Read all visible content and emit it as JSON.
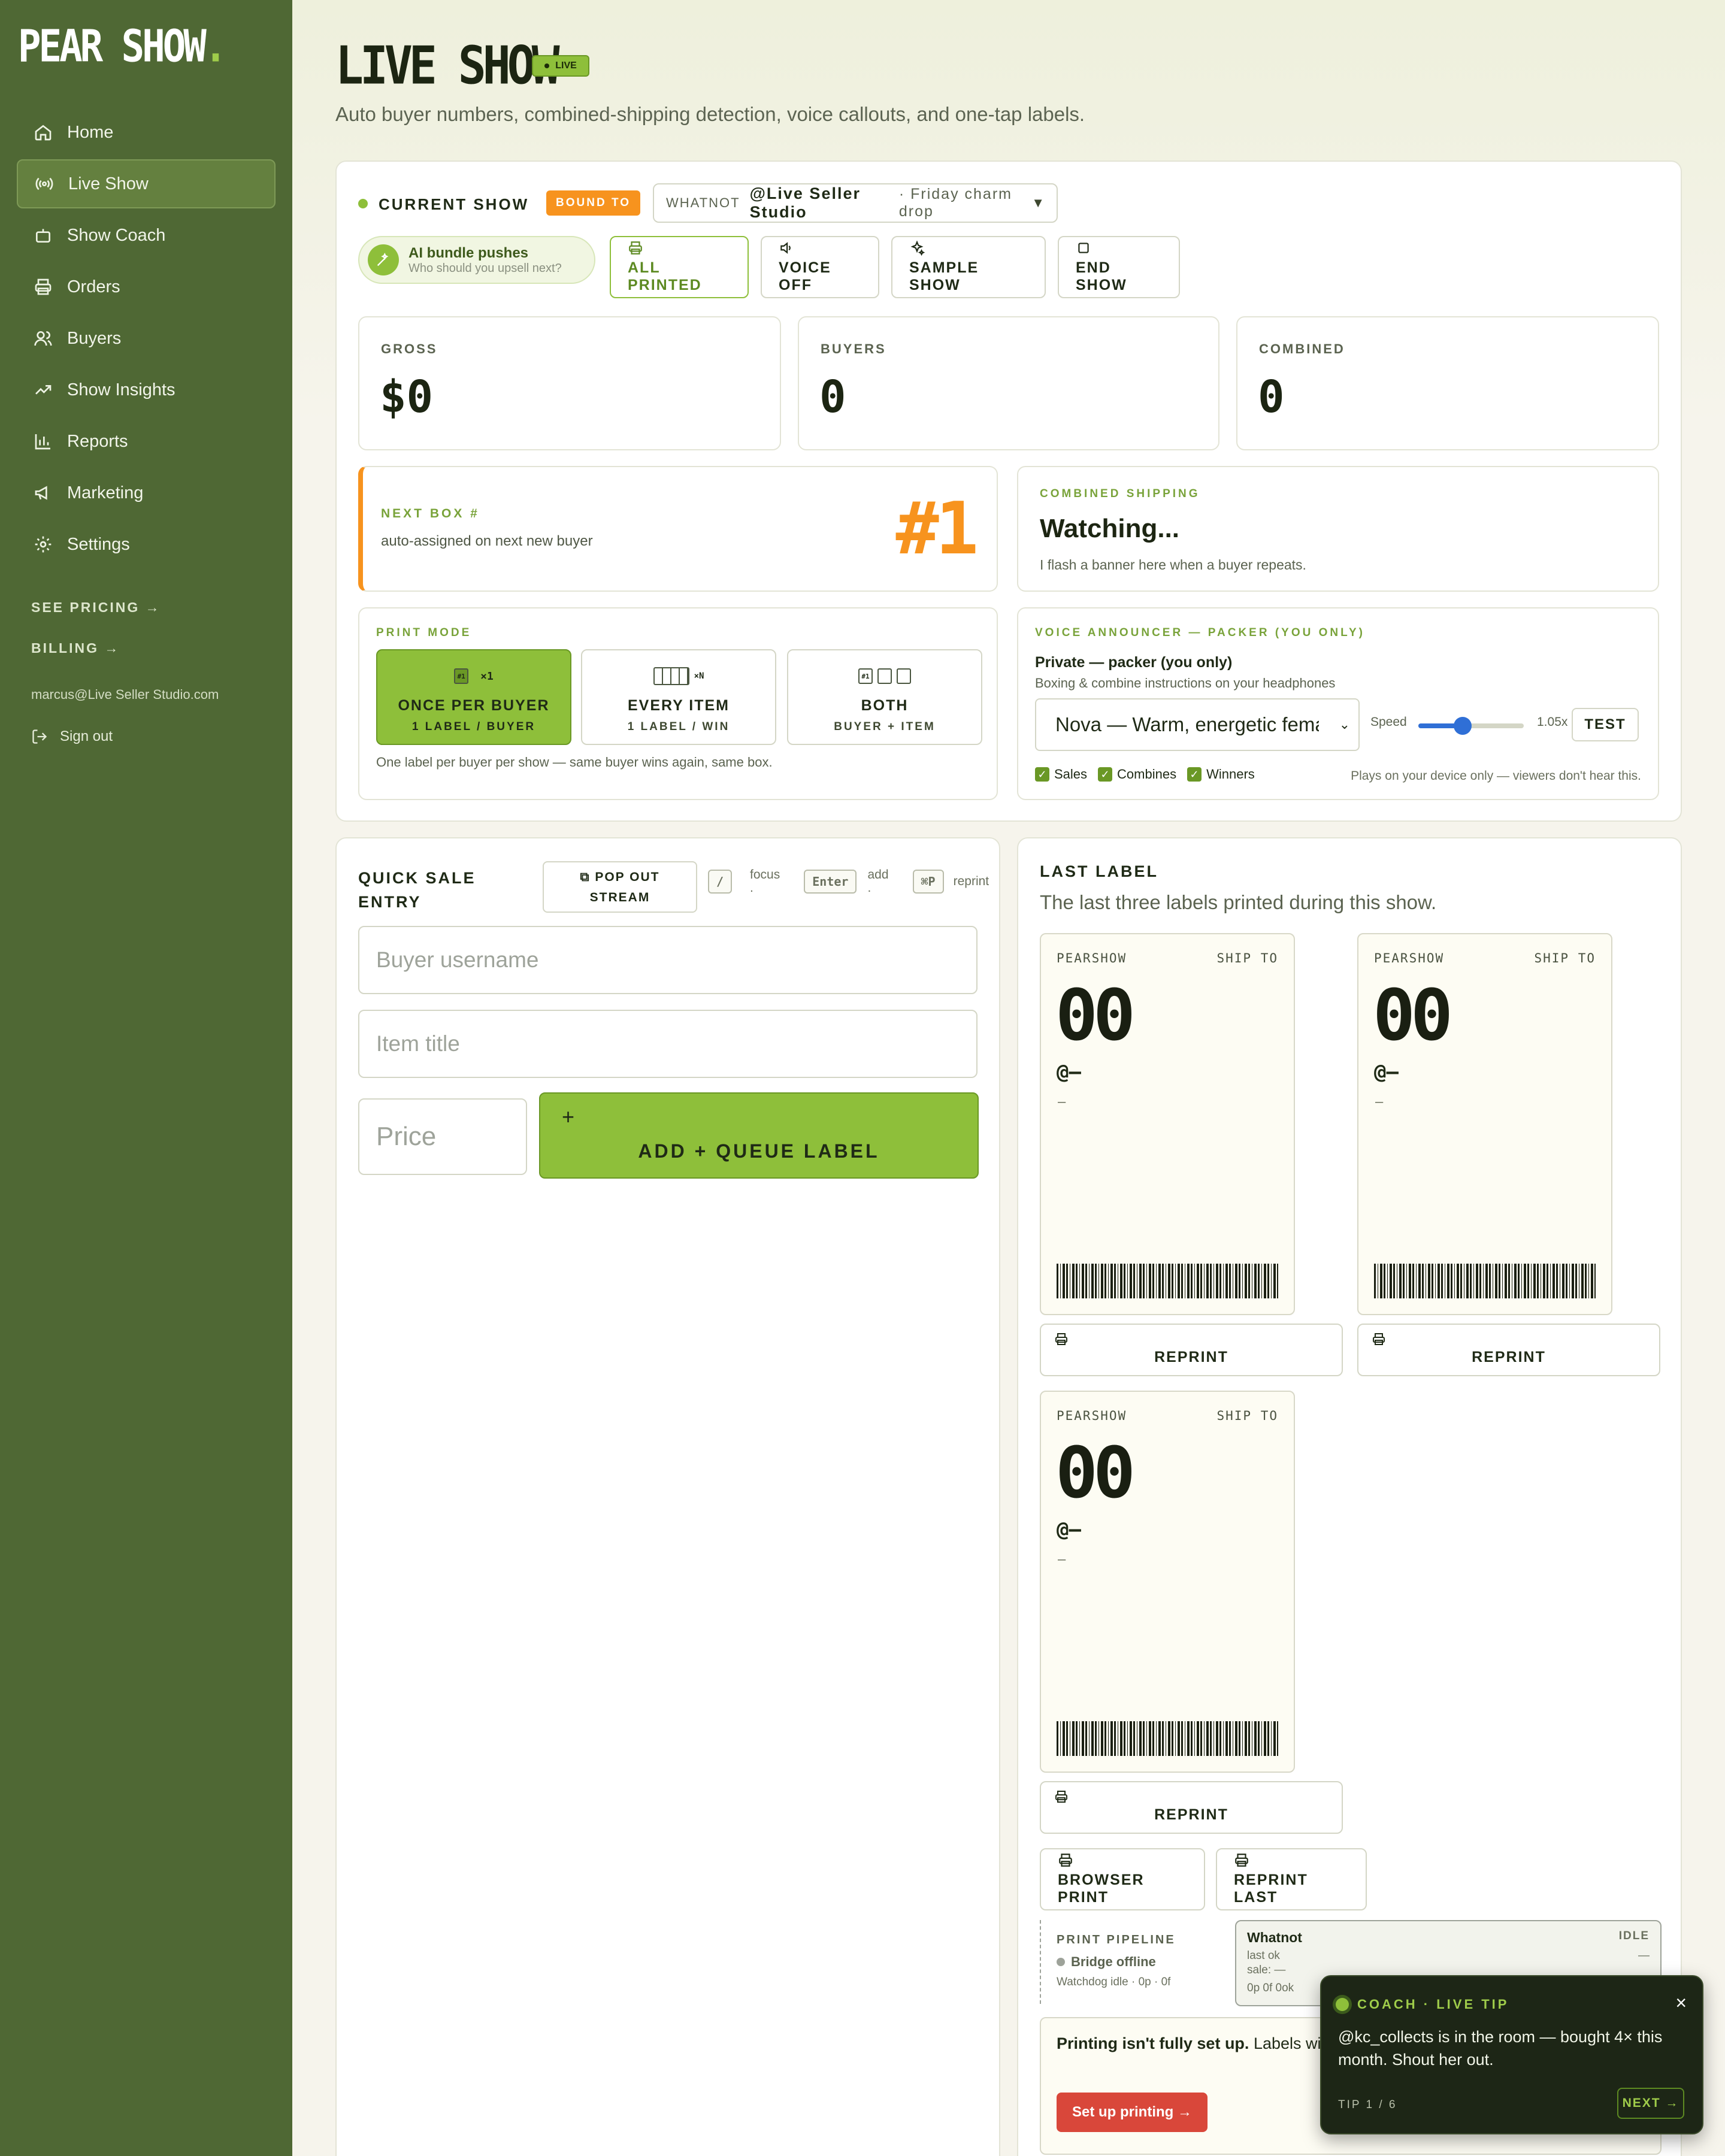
{
  "sidebar": {
    "brand": "PEAR SHOW",
    "brand_dot": ".",
    "items": [
      {
        "label": "Home",
        "icon": "home-icon"
      },
      {
        "label": "Live Show",
        "icon": "broadcast-icon",
        "active": true
      },
      {
        "label": "Show Coach",
        "icon": "robot-icon"
      },
      {
        "label": "Orders",
        "icon": "printer-icon"
      },
      {
        "label": "Buyers",
        "icon": "users-icon"
      },
      {
        "label": "Show Insights",
        "icon": "trending-up-icon"
      },
      {
        "label": "Reports",
        "icon": "bar-chart-icon"
      },
      {
        "label": "Marketing",
        "icon": "megaphone-icon"
      },
      {
        "label": "Settings",
        "icon": "gear-icon"
      }
    ],
    "see_pricing": "SEE PRICING →",
    "billing": "BILLING →",
    "email": "marcus@Live Seller Studio.com",
    "sign_out": "Sign out"
  },
  "header": {
    "title": "LIVE SHOW",
    "badge": "LIVE",
    "subtitle": "Auto buyer numbers, combined-shipping detection, voice callouts, and one-tap labels."
  },
  "current_show": {
    "label": "CURRENT SHOW",
    "bound_badge": "BOUND TO",
    "platform": "WHATNOT",
    "account": "@Live Seller Studio",
    "show_name": "· Friday charm drop",
    "ai_pill_title": "AI bundle pushes",
    "ai_pill_sub": "Who should you upsell next?",
    "buttons": {
      "all_printed": "ALL PRINTED",
      "voice_off": "VOICE OFF",
      "sample_show": "SAMPLE SHOW",
      "end_show": "END SHOW"
    }
  },
  "stats": {
    "gross_label": "GROSS",
    "gross": "$0",
    "buyers_label": "BUYERS",
    "buyers": "0",
    "combined_label": "COMBINED",
    "combined": "0"
  },
  "next_box": {
    "label": "NEXT BOX #",
    "desc": "auto-assigned on next new buyer",
    "number": "#1"
  },
  "combined_shipping": {
    "label": "COMBINED SHIPPING",
    "status": "Watching...",
    "desc": "I flash a banner here when a buyer repeats."
  },
  "print_mode": {
    "label": "PRINT MODE",
    "modes": [
      {
        "title": "ONCE PER BUYER",
        "sub": "1 LABEL / BUYER",
        "glyph": "#1",
        "mult": "×1",
        "active": true
      },
      {
        "title": "EVERY ITEM",
        "sub": "1 LABEL / WIN",
        "mult": "×N"
      },
      {
        "title": "BOTH",
        "sub": "BUYER + ITEM",
        "glyph": "#1"
      }
    ],
    "note": "One label per buyer per show — same buyer wins again, same box."
  },
  "voice": {
    "label": "VOICE ANNOUNCER — PACKER (YOU ONLY)",
    "title": "Private — packer (you only)",
    "desc": "Boxing & combine instructions on your headphones",
    "selected_voice": "Nova — Warm, energetic female",
    "speed_label": "Speed",
    "speed_value": "1.05x",
    "speed_fraction": 0.42,
    "test_label": "TEST",
    "checks": [
      {
        "label": "Sales",
        "checked": true
      },
      {
        "label": "Combines",
        "checked": true
      },
      {
        "label": "Winners",
        "checked": true
      }
    ],
    "device_note": "Plays on your device only — viewers don't hear this."
  },
  "quick_sale": {
    "title_1": "QUICK SALE",
    "title_2": "ENTRY",
    "pop_out_1": "POP OUT",
    "pop_out_2": "STREAM",
    "kbd_focus": "/",
    "focus_label": "focus",
    "kbd_add": "Enter",
    "add_label": "add",
    "kbd_reprint": "⌘P",
    "reprint_label": "reprint",
    "dot": ".",
    "buyer_placeholder": "Buyer username",
    "item_placeholder": "Item title",
    "price_placeholder": "Price",
    "add_plus": "+",
    "add_button": "ADD + QUEUE LABEL"
  },
  "last_label": {
    "title": "LAST LABEL",
    "desc": "The last three labels printed during this show.",
    "labels": [
      {
        "brand": "PEARSHOW",
        "ship_to": "SHIP TO",
        "number": "00",
        "handle": "@—",
        "line": "—"
      },
      {
        "brand": "PEARSHOW",
        "ship_to": "SHIP TO",
        "number": "00",
        "handle": "@—",
        "line": "—"
      },
      {
        "brand": "PEARSHOW",
        "ship_to": "SHIP TO",
        "number": "00",
        "handle": "@—",
        "line": "—"
      }
    ],
    "reprint": "REPRINT",
    "browser_print": "BROWSER PRINT",
    "reprint_last": "REPRINT LAST"
  },
  "pipeline": {
    "label": "PRINT PIPELINE",
    "status": "Bridge offline",
    "watchdog": "Watchdog idle · 0p · 0f",
    "card_title": "Whatnot",
    "card_state": "IDLE",
    "last_ok": "last ok",
    "last_ok_val": "—",
    "sale": "sale: —",
    "counts": "0p  0f  0ok"
  },
  "setup": {
    "text_bold": "Printing isn't fully set up.",
    "text_rest": " Labels will queue until you finish setting up printing.",
    "button": "Set up printing →"
  },
  "coach": {
    "label": "COACH · LIVE TIP",
    "message": "@kc_collects is in the room — bought 4× this month. Shout her out.",
    "counter": "TIP 1 / 6",
    "next": "NEXT →",
    "close": "×"
  },
  "colors": {
    "sidebar": "#4f6834",
    "accent_green": "#8ebf3a",
    "accent_orange": "#f7931e",
    "danger": "#d9473a"
  }
}
